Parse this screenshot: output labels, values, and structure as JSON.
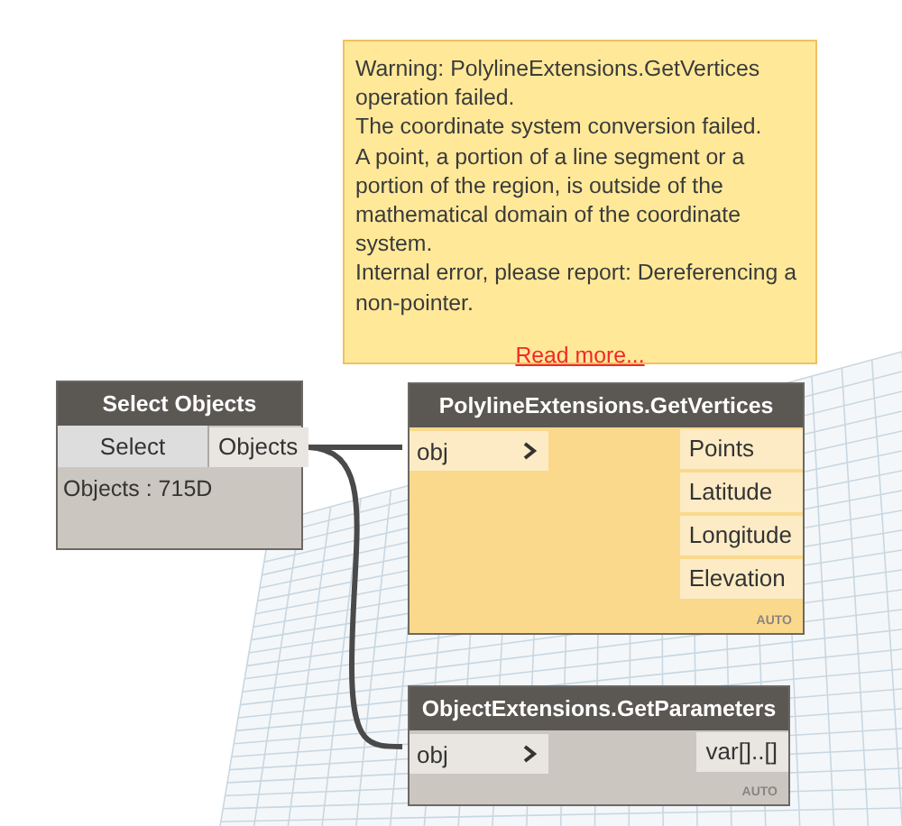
{
  "warning": {
    "paragraphs": [
      "Warning: PolylineExtensions.GetVertices operation failed.",
      "The coordinate system conversion failed.",
      "A point, a portion of a line segment or a portion of the region, is outside of the mathematical domain of the coordinate system.",
      "Internal error, please report: Dereferencing a non-pointer."
    ],
    "link": "Read more..."
  },
  "nodes": [
    {
      "title": "Select Objects",
      "warning": false,
      "button": "Select",
      "outputs": [
        "Objects"
      ],
      "preview": "Objects : 715D"
    },
    {
      "title": "PolylineExtensions.GetVertices",
      "warning": true,
      "inputs": [
        "obj"
      ],
      "outputs": [
        "Points",
        "Latitude",
        "Longitude",
        "Elevation"
      ],
      "lacing": "AUTO"
    },
    {
      "title": "ObjectExtensions.GetParameters",
      "warning": false,
      "inputs": [
        "obj"
      ],
      "outputs": [
        "var[]..[]"
      ],
      "lacing": "AUTO"
    }
  ]
}
